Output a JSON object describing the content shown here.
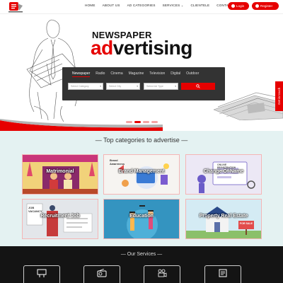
{
  "header": {
    "nav": [
      {
        "label": "HOME",
        "has_caret": false
      },
      {
        "label": "ABOUT US",
        "has_caret": false
      },
      {
        "label": "AD CATEGORIES",
        "has_caret": false
      },
      {
        "label": "SERVICES",
        "has_caret": true
      },
      {
        "label": "CLIENTELE",
        "has_caret": false
      },
      {
        "label": "CONTACT US",
        "has_caret": false
      }
    ],
    "login_label": "Login",
    "register_label": "Register",
    "brand_color": "#e60000"
  },
  "hero": {
    "title_small": "NEWSPAPER",
    "title_big_prefix": "ad",
    "title_big_suffix": "vertising",
    "tabs": [
      "Newspaper",
      "Radio",
      "Cinema",
      "Magazine",
      "Television",
      "Digital",
      "Outdoor"
    ],
    "active_tab_index": 0,
    "fields": [
      {
        "placeholder": "Select Category"
      },
      {
        "placeholder": "Select City"
      },
      {
        "placeholder": "Select Ad Type"
      }
    ],
    "side_tab": "Get in touch",
    "slide_count": 4,
    "active_slide_index": 1
  },
  "categories": {
    "heading": "— Top categories to advertise —",
    "items": [
      {
        "label": "Matrimonial",
        "icon": "wedding-illustration"
      },
      {
        "label": "Brand Management",
        "icon": "brand-awareness-illustration",
        "image_text": "Brand Awareness"
      },
      {
        "label": "Change Of Name",
        "icon": "online-registration-illustration",
        "image_text": "ONLINE REGISTRATION"
      },
      {
        "label": "Recruitment Job",
        "icon": "job-vacancy-illustration",
        "image_text": "JOB VACANCY"
      },
      {
        "label": "Education",
        "icon": "graduates-illustration"
      },
      {
        "label": "Property Real Estate",
        "icon": "for-sale-house-illustration",
        "image_text": "FOR SALE"
      }
    ]
  },
  "services": {
    "heading": "— Our Services —",
    "items": [
      {
        "icon": "billboard-icon"
      },
      {
        "icon": "radio-icon"
      },
      {
        "icon": "film-camera-icon"
      },
      {
        "icon": "newspaper-icon"
      }
    ]
  }
}
